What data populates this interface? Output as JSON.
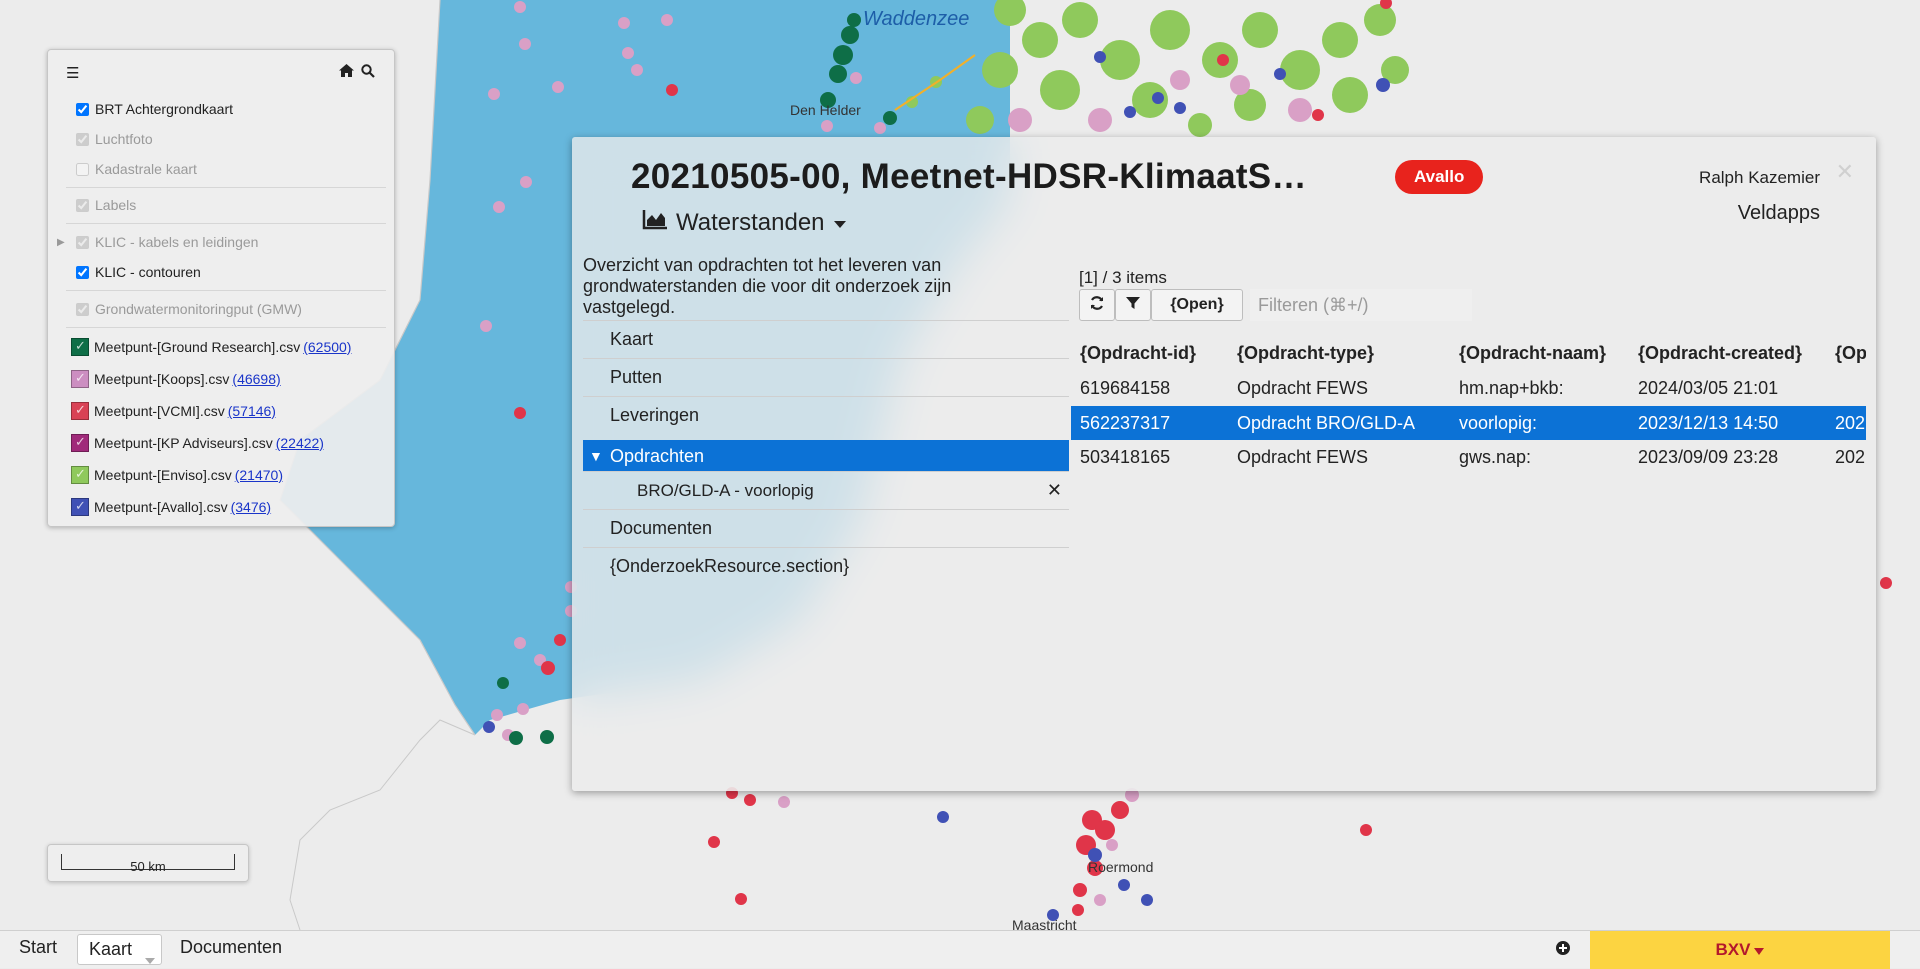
{
  "layers": {
    "toolbar": {
      "menu_icon": "hamburger-icon",
      "home_icon": "home-icon",
      "search_icon": "search-icon"
    },
    "items": [
      {
        "label": "BRT Achtergrondkaart",
        "checked": true
      },
      {
        "label": "Luchtfoto",
        "checked": true
      },
      {
        "label": "Kadastrale kaart",
        "checked": false
      },
      {
        "label": "Labels",
        "checked": true
      },
      {
        "label": "KLIC - kabels en leidingen",
        "checked": true
      },
      {
        "label": "KLIC - contouren",
        "checked": true
      },
      {
        "label": "Grondwatermonitoringput (GMW)",
        "checked": true
      }
    ],
    "meetpunten": [
      {
        "label": "Meetpunt-[Ground Research].csv",
        "count": "(62500)",
        "color": "#0e6e47"
      },
      {
        "label": "Meetpunt-[Koops].csv",
        "count": "(46698)",
        "color": "#cc8ec1"
      },
      {
        "label": "Meetpunt-[VCMI].csv",
        "count": "(57146)",
        "color": "#d94255"
      },
      {
        "label": "Meetpunt-[KP Adviseurs].csv",
        "count": "(22422)",
        "color": "#a02a7a"
      },
      {
        "label": "Meetpunt-[Enviso].csv",
        "count": "(21470)",
        "color": "#8fc95c"
      },
      {
        "label": "Meetpunt-[Avallo].csv",
        "count": "(3476)",
        "color": "#4051b5"
      }
    ]
  },
  "map": {
    "labels": {
      "waddenzee": "Waddenzee"
    },
    "scale_label": "50 km"
  },
  "dialog": {
    "title": "20210505-00, Meetnet-HDSR-KlimaatS…",
    "badge": "Avallo",
    "badge_color": "#e8231d",
    "user": "Ralph Kazemier",
    "app": "Veldapps",
    "view_label": "Waterstanden",
    "description": "Overzicht van opdrachten tot het leveren van grondwaterstanden die voor dit onderzoek zijn vastgelegd.",
    "nav": [
      {
        "label": "Kaart"
      },
      {
        "label": "Putten"
      },
      {
        "label": "Leveringen"
      },
      {
        "label": "Opdrachten",
        "active": true
      },
      {
        "label": "BRO/GLD-A - voorlopig",
        "sub": true
      },
      {
        "label": "Documenten"
      },
      {
        "label": "{OnderzoekResource.section}"
      }
    ],
    "count_text": "[1] / 3 items",
    "open_label": "{Open}",
    "filter_placeholder": "Filteren (⌘+/)",
    "columns": [
      "{Opdracht-id}",
      "{Opdracht-type}",
      "{Opdracht-naam}",
      "{Opdracht-created}",
      "{Op"
    ],
    "rows": [
      [
        "619684158",
        "Opdracht FEWS",
        "hm.nap+bkb:",
        "2024/03/05 21:01",
        ""
      ],
      [
        "562237317",
        "Opdracht BRO/GLD-A",
        "voorlopig:",
        "2023/12/13 14:50",
        "202"
      ],
      [
        "503418165",
        "Opdracht FEWS",
        "gws.nap:",
        "2023/09/09 23:28",
        "202"
      ]
    ],
    "selected_row": 1
  },
  "bottom_bar": {
    "tabs": [
      "Start",
      "Kaart",
      "Documenten"
    ],
    "active_tab": "Kaart",
    "bxv_label": "BXV",
    "bxv_color": "#fcd441"
  }
}
